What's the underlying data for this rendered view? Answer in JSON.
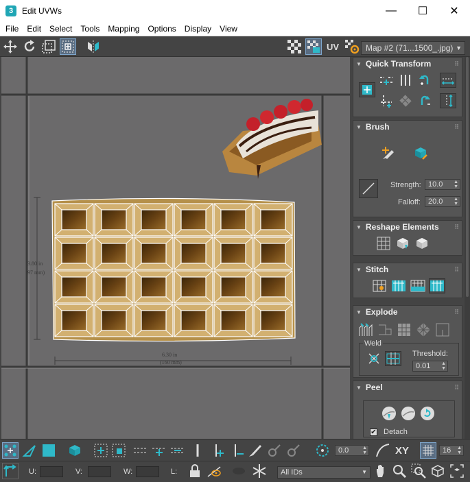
{
  "window": {
    "title": "Edit UVWs",
    "app_icon": "3",
    "minimize": "—",
    "maximize": "☐",
    "close": "✕"
  },
  "menu": [
    "File",
    "Edit",
    "Select",
    "Tools",
    "Mapping",
    "Options",
    "Display",
    "View"
  ],
  "toolbar": {
    "uv_label": "UV",
    "map_select": "Map #2 (71...1500_.jpg)"
  },
  "viewport": {
    "dim_height": "3.80 in",
    "dim_height_mm": "97 mm)",
    "dim_width": "6.30 in",
    "dim_width_mm": "(160 mm)"
  },
  "panel": {
    "quick_transform": {
      "title": "Quick Transform"
    },
    "brush": {
      "title": "Brush",
      "strength_label": "Strength:",
      "strength_value": "10.0",
      "falloff_label": "Falloff:",
      "falloff_value": "20.0"
    },
    "reshape": {
      "title": "Reshape Elements"
    },
    "stitch": {
      "title": "Stitch"
    },
    "explode": {
      "title": "Explode",
      "weld_label": "Weld",
      "threshold_label": "Threshold:",
      "threshold_value": "0.01"
    },
    "peel": {
      "title": "Peel",
      "detach_label": "Detach",
      "detach_checked": true
    }
  },
  "bottom": {
    "rotate_value": "0.0",
    "xy_label": "XY",
    "grid_value": "16",
    "u_label": "U:",
    "v_label": "V:",
    "w_label": "W:",
    "l_label": "L:",
    "ids_select": "All IDs"
  },
  "colors": {
    "accent": "#2fb9c9",
    "background": "#444444",
    "viewport": "#6b6a6b",
    "uv_lines": "#ffffff"
  }
}
